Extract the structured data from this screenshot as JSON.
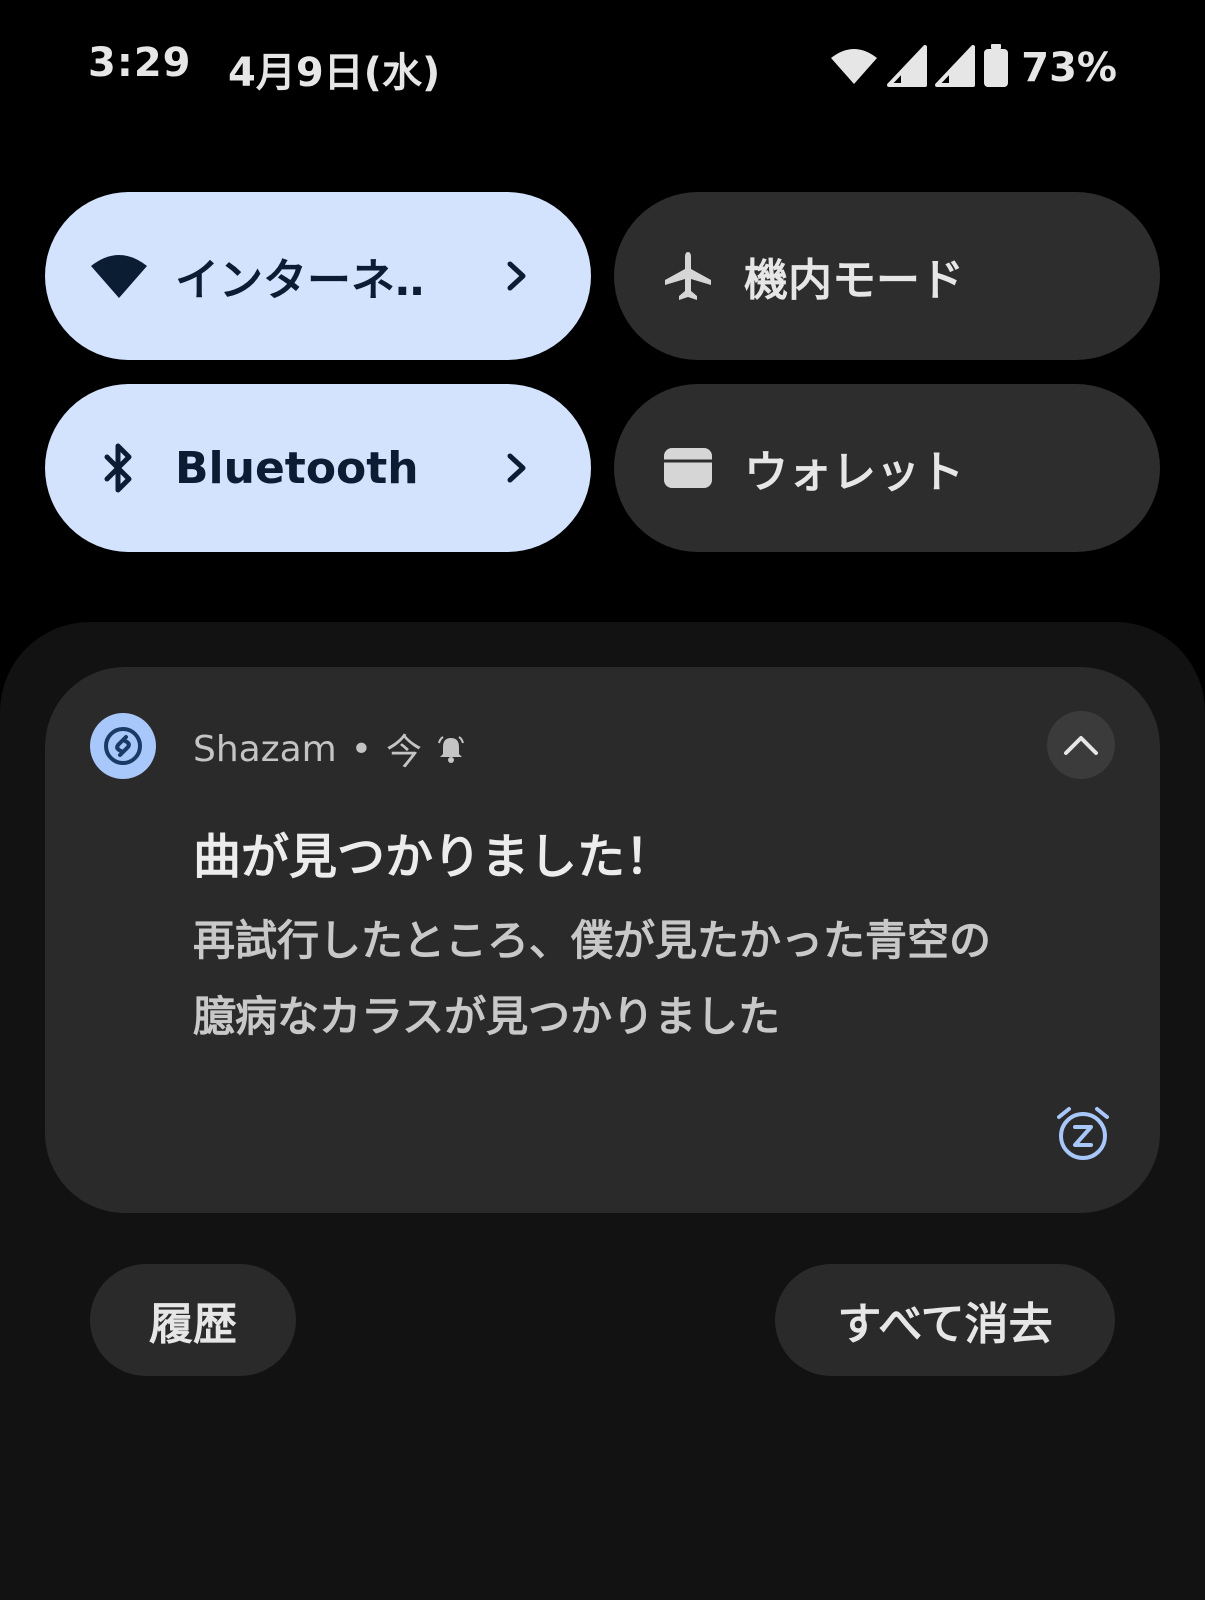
{
  "status_bar": {
    "time": "3:29",
    "date": "4月9日(水)",
    "battery_percent": "73%",
    "icons": [
      "wifi-icon",
      "signal-icon",
      "signal-icon",
      "battery-icon"
    ]
  },
  "quick_tiles": [
    {
      "label": "インターネ‥",
      "icon": "wifi-icon",
      "state": "on",
      "has_chevron": true
    },
    {
      "label": "機内モード",
      "icon": "airplane-icon",
      "state": "off",
      "has_chevron": false
    },
    {
      "label": "Bluetooth",
      "icon": "bluetooth-icon",
      "state": "on",
      "has_chevron": true
    },
    {
      "label": "ウォレット",
      "icon": "wallet-icon",
      "state": "off",
      "has_chevron": false
    }
  ],
  "notification": {
    "app_name": "Shazam",
    "separator": "•",
    "time": "今",
    "title": "曲が見つかりました！",
    "body_lines": [
      "再試行したところ、僕が見たかった青空の",
      "臆病なカラスが見つかりました"
    ],
    "app_icon": "shazam-icon",
    "alert_icon": "bell-icon",
    "snooze_icon": "snooze-icon"
  },
  "actions": {
    "history_label": "履歴",
    "clear_all_label": "すべて消去"
  },
  "colors": {
    "background": "#000000",
    "tile_active": "#d3e3fd",
    "tile_inactive": "#2d2d2d",
    "card": "#2a2a2a",
    "accent": "#a8c7fa"
  }
}
